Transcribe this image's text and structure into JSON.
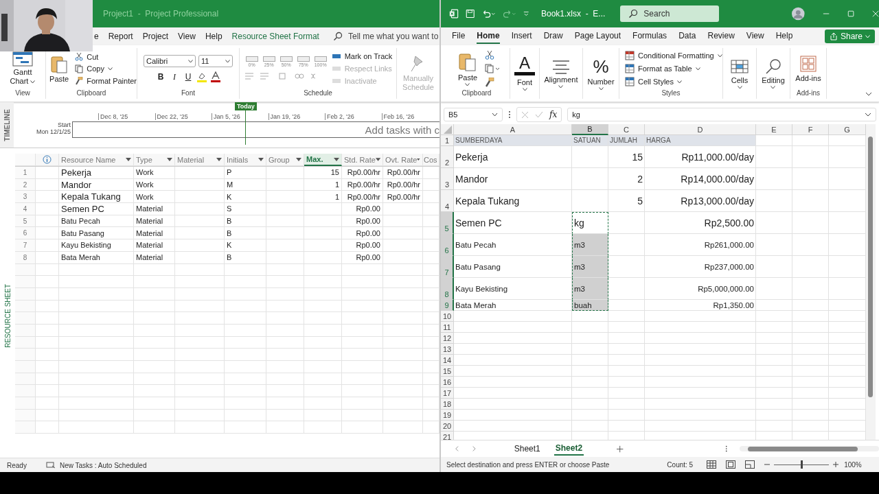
{
  "project": {
    "title": "Project1  -  Project Professional",
    "tabs": [
      {
        "label": "e",
        "contextual": false
      },
      {
        "label": "Report",
        "contextual": false
      },
      {
        "label": "Project",
        "contextual": false
      },
      {
        "label": "View",
        "contextual": false
      },
      {
        "label": "Help",
        "contextual": false
      },
      {
        "label": "Resource Sheet Format",
        "contextual": true
      }
    ],
    "tell_me": "Tell me what you want to",
    "ribbon": {
      "gantt": "Gantt Chart",
      "paste": "Paste",
      "cut": "Cut",
      "copy": "Copy",
      "format_painter": "Format Painter",
      "font_name": "Calibri",
      "font_size": "11",
      "styles": [
        "B",
        "I",
        "U"
      ],
      "percent_buttons": [
        "0%",
        "25%",
        "50%",
        "75%",
        "100%"
      ],
      "schedule_items": [
        {
          "label": "Mark on Track",
          "disabled": false
        },
        {
          "label": "Respect Links",
          "disabled": true
        },
        {
          "label": "Inactivate",
          "disabled": true
        }
      ],
      "manual": {
        "label": "Manually Schedule",
        "disabled": true
      },
      "groups": [
        "View",
        "Clipboard",
        "Font",
        "Schedule"
      ]
    },
    "timeline": {
      "label": "TIMELINE",
      "dates": [
        "Dec 8, '25",
        "Dec 22, '25",
        "Jan 5, '26",
        "Jan 19, '26",
        "Feb 2, '26",
        "Feb 16, '26"
      ],
      "today": "Today",
      "start_label": "Start",
      "start_date": "Mon 12/1/25",
      "hint": "Add tasks with c"
    },
    "sheet": {
      "side_label": "RESOURCE SHEET",
      "columns": [
        {
          "label": "Resource Name",
          "selected": false,
          "filter": true
        },
        {
          "label": "Type",
          "selected": false,
          "filter": true
        },
        {
          "label": "Material",
          "selected": false,
          "filter": true
        },
        {
          "label": "Initials",
          "selected": false,
          "filter": true
        },
        {
          "label": "Group",
          "selected": false,
          "filter": true
        },
        {
          "label": "Max.",
          "selected": true,
          "filter": true
        },
        {
          "label": "Std. Rate",
          "selected": false,
          "filter": true
        },
        {
          "label": "Ovt. Rate",
          "selected": false,
          "filter": true
        },
        {
          "label": "Cos",
          "selected": false
        }
      ],
      "rows": [
        {
          "num": "1",
          "kind": "large",
          "name": "Pekerja",
          "type": "Work",
          "initials": "P",
          "max": "15",
          "std_rate": "Rp0.00/hr",
          "ovt_rate": "Rp0.00/hr"
        },
        {
          "num": "2",
          "kind": "large",
          "name": "Mandor",
          "type": "Work",
          "initials": "M",
          "max": "1",
          "std_rate": "Rp0.00/hr",
          "ovt_rate": "Rp0.00/hr"
        },
        {
          "num": "3",
          "kind": "large",
          "name": "Kepala Tukang",
          "type": "Work",
          "initials": "K",
          "max": "1",
          "std_rate": "Rp0.00/hr",
          "ovt_rate": "Rp0.00/hr"
        },
        {
          "num": "4",
          "kind": "large",
          "name": "Semen PC",
          "type": "Material",
          "initials": "S",
          "std_rate": "Rp0.00"
        },
        {
          "num": "5",
          "kind": "normal",
          "name": "Batu Pecah",
          "type": "Material",
          "initials": "B",
          "std_rate": "Rp0.00"
        },
        {
          "num": "6",
          "kind": "normal",
          "name": "Batu Pasang",
          "type": "Material",
          "initials": "B",
          "std_rate": "Rp0.00"
        },
        {
          "num": "7",
          "kind": "normal",
          "name": "Kayu Bekisting",
          "type": "Material",
          "initials": "K",
          "std_rate": "Rp0.00"
        },
        {
          "num": "8",
          "kind": "normal",
          "name": "Bata Merah",
          "type": "Material",
          "initials": "B",
          "std_rate": "Rp0.00"
        }
      ]
    },
    "status": {
      "ready": "Ready",
      "mode": "New Tasks : Auto Scheduled"
    }
  },
  "excel": {
    "title": "Book1.xlsx  -  E...",
    "search": "Search",
    "tabs": [
      {
        "label": "File",
        "selected": false
      },
      {
        "label": "Home",
        "selected": true
      },
      {
        "label": "Insert",
        "selected": false
      },
      {
        "label": "Draw",
        "selected": false
      },
      {
        "label": "Page Layout",
        "selected": false
      },
      {
        "label": "Formulas",
        "selected": false
      },
      {
        "label": "Data",
        "selected": false
      },
      {
        "label": "Review",
        "selected": false
      },
      {
        "label": "View",
        "selected": false
      },
      {
        "label": "Help",
        "selected": false
      }
    ],
    "share": "Share",
    "ribbon": {
      "paste": "Paste",
      "font": "Font",
      "font_icon": "A",
      "alignment": "Alignment",
      "number": "Number",
      "number_icon": "%",
      "styles": [
        {
          "label": "Conditional Formatting",
          "kind": "conditional"
        },
        {
          "label": "Format as Table",
          "kind": "table"
        },
        {
          "label": "Cell Styles",
          "kind": "cellstyles"
        }
      ],
      "cells": "Cells",
      "editing": "Editing",
      "addins": "Add-ins",
      "group_clipboard": "Clipboard",
      "group_styles": "Styles",
      "group_addins": "Add-ins"
    },
    "formula": {
      "name_box": "B5",
      "fx": "fx",
      "value": "kg"
    },
    "grid": {
      "columns": [
        {
          "label": "A",
          "selected": false
        },
        {
          "label": "B",
          "selected": true
        },
        {
          "label": "C",
          "selected": false
        },
        {
          "label": "D",
          "selected": false
        },
        {
          "label": "E",
          "selected": false
        },
        {
          "label": "F",
          "selected": false
        },
        {
          "label": "G",
          "selected": false
        }
      ],
      "rows": [
        {
          "num": "1",
          "kind": "header",
          "a": "SUMBERDAYA",
          "b": "SATUAN",
          "c": "JUMLAH",
          "d": "HARGA",
          "selected": false,
          "active": false
        },
        {
          "num": "2",
          "kind": "large",
          "a": "Pekerja",
          "c": "15",
          "d": "Rp11,000.00/day",
          "selected": false,
          "active": false
        },
        {
          "num": "3",
          "kind": "large",
          "a": "Mandor",
          "c": "2",
          "d": "Rp14,000.00/day",
          "selected": false,
          "active": false
        },
        {
          "num": "4",
          "kind": "large",
          "a": "Kepala Tukang",
          "c": "5",
          "d": "Rp13,000.00/day",
          "selected": false,
          "active": false
        },
        {
          "num": "5",
          "kind": "large",
          "a": "Semen PC",
          "b": "kg",
          "d": "Rp2,500.00",
          "selected": true,
          "active": true
        },
        {
          "num": "6",
          "kind": "medium",
          "a": "Batu Pecah",
          "b": "m3",
          "d": "Rp261,000.00",
          "selected": true,
          "active": false
        },
        {
          "num": "7",
          "kind": "medium",
          "a": "Batu Pasang",
          "b": "m3",
          "d": "Rp237,000.00",
          "selected": true,
          "active": false
        },
        {
          "num": "8",
          "kind": "medium",
          "a": "Kayu Bekisting",
          "b": "m3",
          "d": "Rp5,000,000.00",
          "selected": true,
          "active": false
        },
        {
          "num": "9",
          "kind": "small",
          "a": "Bata Merah",
          "b": "buah",
          "d": "Rp1,350.00",
          "selected": true,
          "active": false
        }
      ],
      "empty_rows": [
        "10",
        "11",
        "12",
        "13",
        "14",
        "15",
        "16",
        "17",
        "18",
        "19",
        "20",
        "21"
      ]
    },
    "sheets": [
      {
        "label": "Sheet1",
        "selected": false
      },
      {
        "label": "Sheet2",
        "selected": true
      }
    ],
    "status": {
      "message": "Select destination and press ENTER or choose Paste",
      "count": "Count: 5",
      "zoom": "100%",
      "level": 0.5
    }
  }
}
